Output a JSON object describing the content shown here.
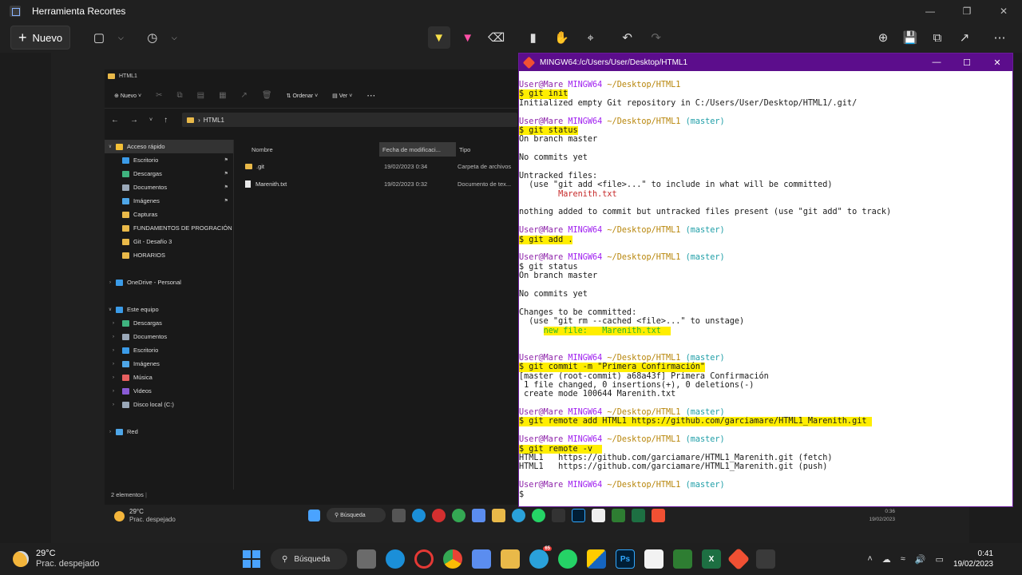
{
  "snip": {
    "title": "Herramienta Recortes",
    "new_label": "Nuevo"
  },
  "explorer": {
    "title": "HTML1",
    "cmd": {
      "new": "Nuevo",
      "sort": "Ordenar",
      "view": "Ver"
    },
    "address": "HTML1",
    "sidebar": [
      {
        "label": "Acceso rápido",
        "icon": "star-icon",
        "level": 0,
        "pinned": false,
        "selected": true
      },
      {
        "label": "Escritorio",
        "icon": "desktop-icon",
        "level": 1,
        "pinned": true
      },
      {
        "label": "Descargas",
        "icon": "download-icon",
        "level": 1,
        "pinned": true
      },
      {
        "label": "Documentos",
        "icon": "documents-icon",
        "level": 1,
        "pinned": true
      },
      {
        "label": "Imágenes",
        "icon": "images-icon",
        "level": 1,
        "pinned": true
      },
      {
        "label": "Capturas",
        "icon": "folder-icon",
        "level": 1,
        "pinned": false
      },
      {
        "label": "FUNDAMENTOS DE PROGRACIÓN",
        "icon": "folder-icon",
        "level": 1,
        "pinned": false
      },
      {
        "label": "Git - Desafío 3",
        "icon": "folder-icon",
        "level": 1,
        "pinned": false
      },
      {
        "label": "HORARIOS",
        "icon": "folder-icon",
        "level": 1,
        "pinned": false
      },
      {
        "label": "",
        "icon": "",
        "level": 1,
        "pinned": false
      },
      {
        "label": "OneDrive - Personal",
        "icon": "cloud-icon",
        "level": 0,
        "pinned": false
      },
      {
        "label": "",
        "icon": "",
        "level": 1,
        "pinned": false
      },
      {
        "label": "Este equipo",
        "icon": "pc-icon",
        "level": 0,
        "pinned": false
      },
      {
        "label": "Descargas",
        "icon": "download-icon",
        "level": 1,
        "pinned": false
      },
      {
        "label": "Documentos",
        "icon": "documents-icon",
        "level": 1,
        "pinned": false
      },
      {
        "label": "Escritorio",
        "icon": "desktop-icon",
        "level": 1,
        "pinned": false
      },
      {
        "label": "Imágenes",
        "icon": "images-icon",
        "level": 1,
        "pinned": false
      },
      {
        "label": "Música",
        "icon": "music-icon",
        "level": 1,
        "pinned": false
      },
      {
        "label": "Videos",
        "icon": "video-icon",
        "level": 1,
        "pinned": false
      },
      {
        "label": "Disco local (C:)",
        "icon": "drive-icon",
        "level": 1,
        "pinned": false
      },
      {
        "label": "",
        "icon": "",
        "level": 1,
        "pinned": false
      },
      {
        "label": "Red",
        "icon": "network-icon",
        "level": 0,
        "pinned": false
      }
    ],
    "columns": {
      "name": "Nombre",
      "modified": "Fecha de modificaci...",
      "type": "Tipo"
    },
    "files": [
      {
        "name": ".git",
        "modified": "19/02/2023 0:34",
        "type": "Carpeta de archivos",
        "kind": "folder"
      },
      {
        "name": "Marenith.txt",
        "modified": "19/02/2023 0:32",
        "type": "Documento de tex...",
        "kind": "doc"
      }
    ],
    "status": "2 elementos"
  },
  "inner_taskbar": {
    "temp": "29°C",
    "condition": "Prac. despejado",
    "search": "Búsqueda",
    "time": "0:36",
    "date": "19/02/2023"
  },
  "gitbash": {
    "title": "MINGW64:/c/Users/User/Desktop/HTML1",
    "lines": [
      {
        "t": "prompt",
        "dir": "~/Desktop/HTML1",
        "branch": ""
      },
      {
        "t": "cmd",
        "text": "$ git init",
        "hl": true
      },
      {
        "t": "out",
        "text": "Initialized empty Git repository in C:/Users/User/Desktop/HTML1/.git/"
      },
      {
        "t": "blank"
      },
      {
        "t": "prompt",
        "dir": "~/Desktop/HTML1",
        "branch": "(master)"
      },
      {
        "t": "cmd",
        "text": "$ git status",
        "hl": true
      },
      {
        "t": "out",
        "text": "On branch master"
      },
      {
        "t": "blank"
      },
      {
        "t": "out",
        "text": "No commits yet"
      },
      {
        "t": "blank"
      },
      {
        "t": "out",
        "text": "Untracked files:"
      },
      {
        "t": "out",
        "text": "  (use \"git add <file>...\" to include in what will be committed)"
      },
      {
        "t": "red",
        "text": "        Marenith.txt"
      },
      {
        "t": "blank"
      },
      {
        "t": "out",
        "text": "nothing added to commit but untracked files present (use \"git add\" to track)"
      },
      {
        "t": "blank"
      },
      {
        "t": "prompt",
        "dir": "~/Desktop/HTML1",
        "branch": "(master)"
      },
      {
        "t": "cmd",
        "text": "$ git add .",
        "hl": true
      },
      {
        "t": "blank"
      },
      {
        "t": "prompt",
        "dir": "~/Desktop/HTML1",
        "branch": "(master)"
      },
      {
        "t": "out",
        "text": "$ git status"
      },
      {
        "t": "out",
        "text": "On branch master"
      },
      {
        "t": "blank"
      },
      {
        "t": "out",
        "text": "No commits yet"
      },
      {
        "t": "blank"
      },
      {
        "t": "out",
        "text": "Changes to be committed:"
      },
      {
        "t": "out",
        "text": "  (use \"git rm --cached <file>...\" to unstage)"
      },
      {
        "t": "green",
        "text": "        new file:   Marenith.txt  "
      },
      {
        "t": "blank"
      },
      {
        "t": "blank"
      },
      {
        "t": "prompt",
        "dir": "~/Desktop/HTML1",
        "branch": "(master)"
      },
      {
        "t": "cmd",
        "text": "$ git commit -m \"Primera Confirmación\"",
        "hl": true
      },
      {
        "t": "out",
        "text": "[master (root-commit) a68a43f] Primera Confirmación"
      },
      {
        "t": "out",
        "text": " 1 file changed, 0 insertions(+), 0 deletions(-)"
      },
      {
        "t": "out",
        "text": " create mode 100644 Marenith.txt"
      },
      {
        "t": "blank"
      },
      {
        "t": "prompt",
        "dir": "~/Desktop/HTML1",
        "branch": "(master)"
      },
      {
        "t": "cmd",
        "text": "$ git remote add HTML1 https://github.com/garciamare/HTML1_Marenith.git ",
        "hl": true
      },
      {
        "t": "blank"
      },
      {
        "t": "prompt",
        "dir": "~/Desktop/HTML1",
        "branch": "(master)"
      },
      {
        "t": "cmd",
        "text": "$ git remote -v  ",
        "hl": true
      },
      {
        "t": "out",
        "text": "HTML1   https://github.com/garciamare/HTML1_Marenith.git (fetch)"
      },
      {
        "t": "out",
        "text": "HTML1   https://github.com/garciamare/HTML1_Marenith.git (push)"
      },
      {
        "t": "blank"
      },
      {
        "t": "prompt",
        "dir": "~/Desktop/HTML1",
        "branch": "(master)"
      },
      {
        "t": "out",
        "text": "$"
      }
    ],
    "user": "User@Mare",
    "host": "MINGW64"
  },
  "taskbar": {
    "temp": "29°C",
    "condition": "Prac. despejado",
    "search": "Búsqueda",
    "notif_badge": "65",
    "time": "0:41",
    "date": "19/02/2023"
  },
  "colors": {
    "highlight": "#ffee00",
    "gitbash_title": "#5c0d8c",
    "prompt_user": "#8e24aa",
    "prompt_branch": "#1e9ea7"
  }
}
